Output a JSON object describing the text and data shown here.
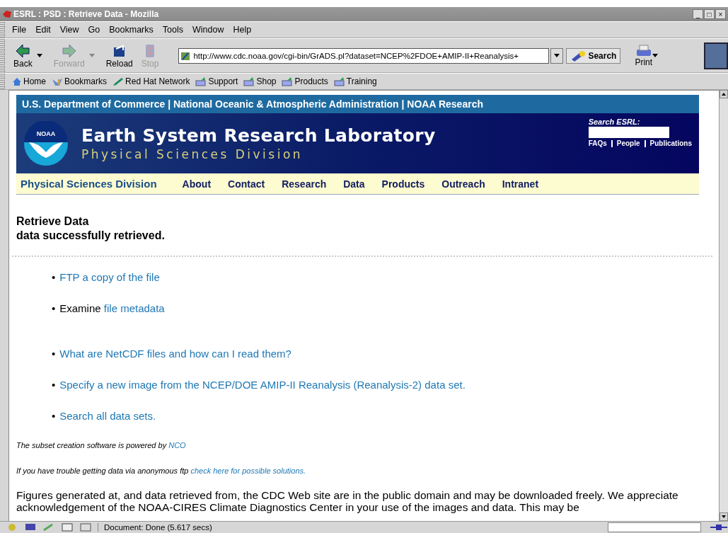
{
  "window": {
    "title": "ESRL : PSD : Retrieve Data - Mozilla",
    "controls": [
      "_",
      "□",
      "×"
    ]
  },
  "menu": [
    "File",
    "Edit",
    "View",
    "Go",
    "Bookmarks",
    "Tools",
    "Window",
    "Help"
  ],
  "nav_buttons": [
    {
      "kind": "back",
      "label": "Back",
      "disabled": false,
      "dropdown": true
    },
    {
      "kind": "forward",
      "label": "Forward",
      "disabled": true,
      "dropdown": true
    },
    {
      "kind": "reload",
      "label": "Reload",
      "disabled": false,
      "dropdown": false
    },
    {
      "kind": "stop",
      "label": "Stop",
      "disabled": true,
      "dropdown": false
    }
  ],
  "address": {
    "value": "http://www.cdc.noaa.gov/cgi-bin/GrADS.pl?dataset=NCEP%2FDOE+AMIP-II+Reanalysis+"
  },
  "search_button": "Search",
  "print_button": "Print",
  "personal_toolbar": [
    {
      "kind": "home",
      "label": "Home"
    },
    {
      "kind": "bookmarks",
      "label": "Bookmarks"
    },
    {
      "kind": "redhat",
      "label": "Red Hat Network"
    },
    {
      "kind": "folder",
      "label": "Support"
    },
    {
      "kind": "folder",
      "label": "Shop"
    },
    {
      "kind": "folder",
      "label": "Products"
    },
    {
      "kind": "folder",
      "label": "Training"
    }
  ],
  "page": {
    "top_bar": "U.S. Department of Commerce | National Oceanic & Atmospheric Administration | NOAA Research",
    "logo": "NOAA",
    "lab_title": "Earth System Research Laboratory",
    "division": "Physical Sciences Division",
    "search_label": "Search ESRL:",
    "quick_links": [
      "FAQs",
      "People",
      "Publications"
    ],
    "nav_title": "Physical Sciences Division",
    "nav": [
      "About",
      "Contact",
      "Research",
      "Data",
      "Products",
      "Outreach",
      "Intranet"
    ],
    "heading": "Retrieve Data",
    "subheading": "data successfully retrieved.",
    "items": [
      {
        "bullet": "•",
        "link": "FTP a copy of the file"
      },
      {
        "bullet": "•",
        "prefix": "Examine ",
        "link": "file metadata"
      },
      {
        "bullet": "•",
        "link": "What are NetCDF files and how can I read them?"
      },
      {
        "bullet": "•",
        "link": "Specify a new image from the NCEP/DOE AMIP-II Reanalysis (Reanalysis-2) data set."
      },
      {
        "bullet": "•",
        "link": "Search all data sets."
      }
    ],
    "notes": [
      {
        "text": "The subset creation software is powered by ",
        "link": "NCO"
      },
      {
        "text": "If you have trouble getting data via anonymous ftp ",
        "link": "check here for possible solutions."
      }
    ],
    "footer": "Figures generated at, and data retrieved from, the CDC Web site are in the public domain and may be downloaded freely. We appreciate acknowledgement of the NOAA-CIRES Climate Diagnostics Center in your use of the images and data. This may be"
  },
  "status_bar": {
    "text": "Document: Done (5.617 secs)"
  }
}
